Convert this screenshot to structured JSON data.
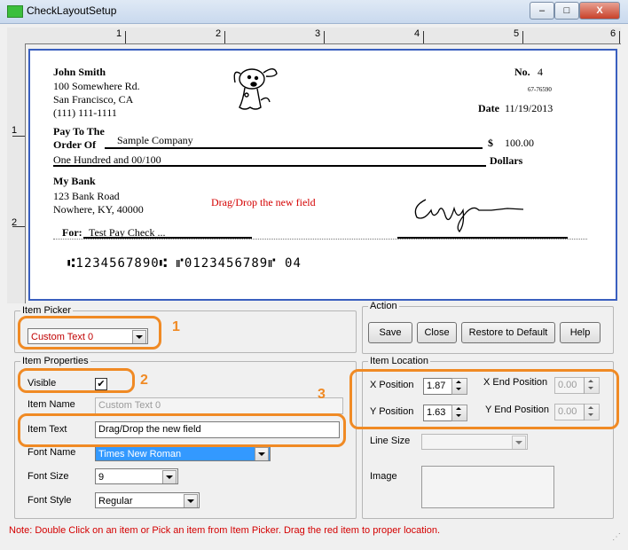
{
  "window": {
    "title": "CheckLayoutSetup",
    "min": "–",
    "max": "□",
    "close": "X"
  },
  "ruler": {
    "top": [
      "1",
      "2",
      "3",
      "4",
      "5",
      "6"
    ],
    "left": [
      "1",
      "2"
    ]
  },
  "check": {
    "payer_name": "John Smith",
    "payer_addr1": "100 Somewhere Rd.",
    "payer_addr2": "San Francisco, CA",
    "payer_phone": "(111) 111-1111",
    "no_label": "No.",
    "no_value": "4",
    "routing_fraction": "67-76590",
    "date_label": "Date",
    "date_value": "11/19/2013",
    "pay_to_label1": "Pay To The",
    "pay_to_label2": "Order Of",
    "payee": "Sample Company",
    "dollar_sign": "$",
    "amount": "100.00",
    "amount_words": "One Hundred  and 00/100",
    "dollars_label": "Dollars",
    "bank_name": "My Bank",
    "bank_addr1": "123 Bank Road",
    "bank_addr2": "Nowhere, KY, 40000",
    "custom_text": "Drag/Drop the new field",
    "for_label": "For:",
    "memo": "Test Pay Check ...",
    "micr": "⑆1234567890⑆  ⑈0123456789⑈   04"
  },
  "item_picker": {
    "legend": "Item Picker",
    "selected": "Custom Text 0"
  },
  "action": {
    "legend": "Action",
    "save": "Save",
    "close": "Close",
    "restore": "Restore to Default",
    "help": "Help"
  },
  "item_properties": {
    "legend": "Item Properties",
    "visible_label": "Visible",
    "visible_checked": "✔",
    "item_name_label": "Item Name",
    "item_name_value": "Custom Text 0",
    "item_text_label": "Item Text",
    "item_text_value": "Drag/Drop the new field",
    "font_name_label": "Font Name",
    "font_name_value": "Times New Roman",
    "font_size_label": "Font Size",
    "font_size_value": "9",
    "font_style_label": "Font Style",
    "font_style_value": "Regular"
  },
  "item_location": {
    "legend": "Item Location",
    "x_label": "X Position",
    "x_value": "1.87",
    "y_label": "Y Position",
    "y_value": "1.63",
    "xend_label": "X End Position",
    "xend_value": "0.00",
    "yend_label": "Y End Position",
    "yend_value": "0.00",
    "line_size_label": "Line Size",
    "image_label": "Image"
  },
  "annotations": {
    "n1": "1",
    "n2": "2",
    "n3": "3",
    "color": "#f08a24"
  },
  "status": "Note: Double Click on an item or Pick an item from Item Picker. Drag the red item to proper location."
}
